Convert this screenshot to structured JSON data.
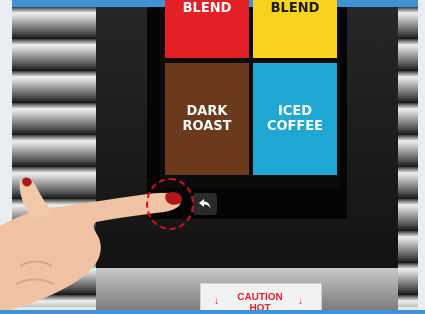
{
  "screen": {
    "tiles": [
      {
        "label": "BLEND",
        "color": "#e41f26"
      },
      {
        "label": "BLEND",
        "color": "#f7d21e"
      },
      {
        "label": "DARK\nROAST",
        "color": "#6b3a1c"
      },
      {
        "label": "ICED\nCOFFEE",
        "color": "#1fa7d4"
      }
    ],
    "back_button": {
      "icon": "back-arrow-icon"
    }
  },
  "caution_label": {
    "text": "CAUTION\nHOT"
  },
  "accent_colors": {
    "border": "#3f92d6",
    "touch_ring": "#d4121a",
    "caution_red": "#e0202a"
  }
}
